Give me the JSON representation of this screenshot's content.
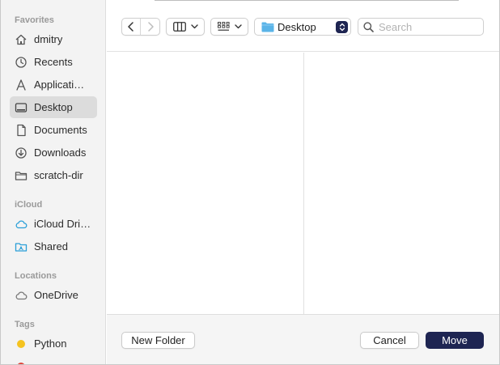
{
  "sidebar": {
    "sections": [
      {
        "title": "Favorites",
        "items": [
          {
            "label": "dmitry",
            "icon": "home-icon"
          },
          {
            "label": "Recents",
            "icon": "clock-icon"
          },
          {
            "label": "Applicati…",
            "icon": "applications-icon"
          },
          {
            "label": "Desktop",
            "icon": "desktop-icon",
            "selected": true
          },
          {
            "label": "Documents",
            "icon": "document-icon"
          },
          {
            "label": "Downloads",
            "icon": "download-icon"
          },
          {
            "label": "scratch-dir",
            "icon": "folder-icon"
          }
        ]
      },
      {
        "title": "iCloud",
        "items": [
          {
            "label": "iCloud Dri…",
            "icon": "icloud-icon"
          },
          {
            "label": "Shared",
            "icon": "shared-folder-icon"
          }
        ]
      },
      {
        "title": "Locations",
        "items": [
          {
            "label": "OneDrive",
            "icon": "cloud-icon"
          }
        ]
      },
      {
        "title": "Tags",
        "items": [
          {
            "label": "Python",
            "icon": "tag-dot-icon",
            "color": "#f5c320"
          }
        ]
      }
    ]
  },
  "toolbar": {
    "back_icon": "chevron-left-icon",
    "forward_icon": "chevron-right-icon",
    "view_icon": "columns-view-icon",
    "group_icon": "grid-group-icon",
    "location": "Desktop",
    "search_placeholder": "Search",
    "search_value": ""
  },
  "footer": {
    "new_folder": "New Folder",
    "cancel": "Cancel",
    "move": "Move"
  },
  "colors": {
    "accent": "#1e2552",
    "sidebar_bg": "#f3f3f3",
    "selected_bg": "#dcdcdc",
    "folder_blue": "#5ab4e8",
    "icloud_blue": "#2a9fd8",
    "tag_python": "#f5c320",
    "tag_red": "#e0443a"
  }
}
